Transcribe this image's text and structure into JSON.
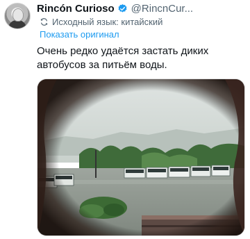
{
  "tweet": {
    "author_name": "Rincón Curioso",
    "handle": "@RincnCur...",
    "source_language": "Исходный язык: китайский",
    "show_original": "Показать оригинал",
    "text_line1": "Очень редко удаётся застать диких",
    "text_line2": "автобусов за питьём воды."
  },
  "icons": {
    "verified": "verified-badge-icon",
    "translate": "translate-icon"
  },
  "colors": {
    "link": "#1d9bf0",
    "verified": "#1d9bf0",
    "secondary_text": "#536471"
  }
}
